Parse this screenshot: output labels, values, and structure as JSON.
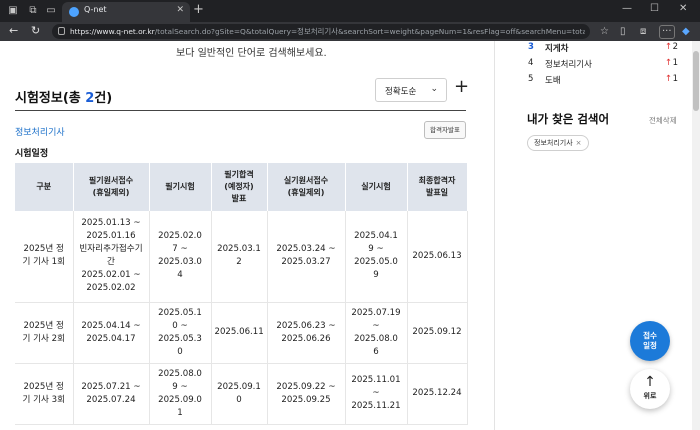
{
  "browser": {
    "tab_title": "Q-net",
    "url_host": "https://www.q-net.or.kr",
    "url_path": "/totalSearch.do?gSite=Q&totalQuery=정보처리기사&searchSort=weight&pageNum=1&resFlag=off&searchMenu=total&gId=&se..."
  },
  "page": {
    "top_hint": "보다 일반적인 단어로 검색해보세요.",
    "section_title_prefix": "시험정보(총 ",
    "section_count": "2",
    "section_title_suffix": "건)",
    "sort_label": "정확도순",
    "cert_name": "정보처리기사",
    "pass_button": "합격자발표",
    "schedule_title": "시험일정",
    "table": {
      "headers": [
        "구분",
        "필기원서접수\n(휴일제외)",
        "필기시험",
        "필기합격\n(예정자)\n발표",
        "실기원서접수\n(휴일제외)",
        "실기시험",
        "최종합격자\n발표일"
      ],
      "rows": [
        [
          "2025년 정\n기 기사 1회",
          "2025.01.13 ~\n2025.01.16\n빈자리추가접수기\n간\n2025.02.01 ~\n2025.02.02",
          "2025.02.0\n7 ~\n2025.03.0\n4",
          "2025.03.1\n2",
          "2025.03.24 ~\n2025.03.27",
          "2025.04.1\n9 ~\n2025.05.0\n9",
          "2025.06.13"
        ],
        [
          "2025년 정\n기 기사 2회",
          "2025.04.14 ~\n2025.04.17",
          "2025.05.1\n0 ~\n2025.05.3\n0",
          "2025.06.11",
          "2025.06.23 ~\n2025.06.26",
          "2025.07.19\n~\n2025.08.0\n6",
          "2025.09.12"
        ],
        [
          "2025년 정\n기 기사 3회",
          "2025.07.21 ~\n2025.07.24",
          "2025.08.0\n9 ~\n2025.09.0\n1",
          "2025.09.1\n0",
          "2025.09.22 ~\n2025.09.25",
          "2025.11.01\n~\n2025.11.21",
          "2025.12.24"
        ]
      ]
    }
  },
  "sidebar": {
    "ranks": [
      {
        "no": "3",
        "term": "지게차",
        "arrow": "↑",
        "val": "2",
        "highlight": true
      },
      {
        "no": "4",
        "term": "정보처리기사",
        "arrow": "↑",
        "val": "1",
        "highlight": false
      },
      {
        "no": "5",
        "term": "도배",
        "arrow": "↑",
        "val": "1",
        "highlight": false
      }
    ],
    "my_search_title": "내가 찾은 검색어",
    "clear_all": "전체삭제",
    "chip_label": "정보처리기사",
    "chip_close": "×"
  },
  "fab": {
    "apply_label": "접수\n일정",
    "top_label": "위로",
    "top_arrow": "↑"
  },
  "colors": {
    "accent": "#1a5dd6",
    "link": "#1a6fc9",
    "up_arrow": "#e03131",
    "table_header": "#dfe4ec",
    "fab_blue": "#1c7ad9"
  }
}
